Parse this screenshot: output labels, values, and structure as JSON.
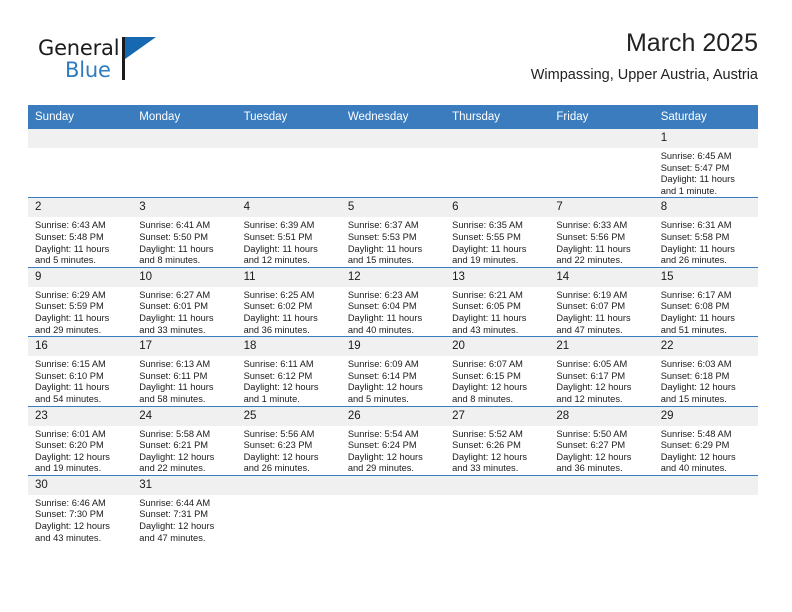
{
  "brand": {
    "name_top": "General",
    "name_bottom": "Blue",
    "triangle_icon": "brand-triangle-icon",
    "accent_color": "#2e7bc0",
    "dark_color": "#1b1b1b"
  },
  "header": {
    "title": "March 2025",
    "subtitle": "Wimpassing, Upper Austria, Austria"
  },
  "theme": {
    "header_blue": "#3a7cbe",
    "daynum_band": "#f0f0f0",
    "grid_line": "#3a7cbe"
  },
  "weekday_headers": [
    "Sunday",
    "Monday",
    "Tuesday",
    "Wednesday",
    "Thursday",
    "Friday",
    "Saturday"
  ],
  "weeks": [
    [
      {
        "day": "",
        "empty": true
      },
      {
        "day": "",
        "empty": true
      },
      {
        "day": "",
        "empty": true
      },
      {
        "day": "",
        "empty": true
      },
      {
        "day": "",
        "empty": true
      },
      {
        "day": "",
        "empty": true
      },
      {
        "day": "1",
        "sunrise": "Sunrise: 6:45 AM",
        "sunset": "Sunset: 5:47 PM",
        "daylight_1": "Daylight: 11 hours",
        "daylight_2": "and 1 minute."
      }
    ],
    [
      {
        "day": "2",
        "sunrise": "Sunrise: 6:43 AM",
        "sunset": "Sunset: 5:48 PM",
        "daylight_1": "Daylight: 11 hours",
        "daylight_2": "and 5 minutes."
      },
      {
        "day": "3",
        "sunrise": "Sunrise: 6:41 AM",
        "sunset": "Sunset: 5:50 PM",
        "daylight_1": "Daylight: 11 hours",
        "daylight_2": "and 8 minutes."
      },
      {
        "day": "4",
        "sunrise": "Sunrise: 6:39 AM",
        "sunset": "Sunset: 5:51 PM",
        "daylight_1": "Daylight: 11 hours",
        "daylight_2": "and 12 minutes."
      },
      {
        "day": "5",
        "sunrise": "Sunrise: 6:37 AM",
        "sunset": "Sunset: 5:53 PM",
        "daylight_1": "Daylight: 11 hours",
        "daylight_2": "and 15 minutes."
      },
      {
        "day": "6",
        "sunrise": "Sunrise: 6:35 AM",
        "sunset": "Sunset: 5:55 PM",
        "daylight_1": "Daylight: 11 hours",
        "daylight_2": "and 19 minutes."
      },
      {
        "day": "7",
        "sunrise": "Sunrise: 6:33 AM",
        "sunset": "Sunset: 5:56 PM",
        "daylight_1": "Daylight: 11 hours",
        "daylight_2": "and 22 minutes."
      },
      {
        "day": "8",
        "sunrise": "Sunrise: 6:31 AM",
        "sunset": "Sunset: 5:58 PM",
        "daylight_1": "Daylight: 11 hours",
        "daylight_2": "and 26 minutes."
      }
    ],
    [
      {
        "day": "9",
        "sunrise": "Sunrise: 6:29 AM",
        "sunset": "Sunset: 5:59 PM",
        "daylight_1": "Daylight: 11 hours",
        "daylight_2": "and 29 minutes."
      },
      {
        "day": "10",
        "sunrise": "Sunrise: 6:27 AM",
        "sunset": "Sunset: 6:01 PM",
        "daylight_1": "Daylight: 11 hours",
        "daylight_2": "and 33 minutes."
      },
      {
        "day": "11",
        "sunrise": "Sunrise: 6:25 AM",
        "sunset": "Sunset: 6:02 PM",
        "daylight_1": "Daylight: 11 hours",
        "daylight_2": "and 36 minutes."
      },
      {
        "day": "12",
        "sunrise": "Sunrise: 6:23 AM",
        "sunset": "Sunset: 6:04 PM",
        "daylight_1": "Daylight: 11 hours",
        "daylight_2": "and 40 minutes."
      },
      {
        "day": "13",
        "sunrise": "Sunrise: 6:21 AM",
        "sunset": "Sunset: 6:05 PM",
        "daylight_1": "Daylight: 11 hours",
        "daylight_2": "and 43 minutes."
      },
      {
        "day": "14",
        "sunrise": "Sunrise: 6:19 AM",
        "sunset": "Sunset: 6:07 PM",
        "daylight_1": "Daylight: 11 hours",
        "daylight_2": "and 47 minutes."
      },
      {
        "day": "15",
        "sunrise": "Sunrise: 6:17 AM",
        "sunset": "Sunset: 6:08 PM",
        "daylight_1": "Daylight: 11 hours",
        "daylight_2": "and 51 minutes."
      }
    ],
    [
      {
        "day": "16",
        "sunrise": "Sunrise: 6:15 AM",
        "sunset": "Sunset: 6:10 PM",
        "daylight_1": "Daylight: 11 hours",
        "daylight_2": "and 54 minutes."
      },
      {
        "day": "17",
        "sunrise": "Sunrise: 6:13 AM",
        "sunset": "Sunset: 6:11 PM",
        "daylight_1": "Daylight: 11 hours",
        "daylight_2": "and 58 minutes."
      },
      {
        "day": "18",
        "sunrise": "Sunrise: 6:11 AM",
        "sunset": "Sunset: 6:12 PM",
        "daylight_1": "Daylight: 12 hours",
        "daylight_2": "and 1 minute."
      },
      {
        "day": "19",
        "sunrise": "Sunrise: 6:09 AM",
        "sunset": "Sunset: 6:14 PM",
        "daylight_1": "Daylight: 12 hours",
        "daylight_2": "and 5 minutes."
      },
      {
        "day": "20",
        "sunrise": "Sunrise: 6:07 AM",
        "sunset": "Sunset: 6:15 PM",
        "daylight_1": "Daylight: 12 hours",
        "daylight_2": "and 8 minutes."
      },
      {
        "day": "21",
        "sunrise": "Sunrise: 6:05 AM",
        "sunset": "Sunset: 6:17 PM",
        "daylight_1": "Daylight: 12 hours",
        "daylight_2": "and 12 minutes."
      },
      {
        "day": "22",
        "sunrise": "Sunrise: 6:03 AM",
        "sunset": "Sunset: 6:18 PM",
        "daylight_1": "Daylight: 12 hours",
        "daylight_2": "and 15 minutes."
      }
    ],
    [
      {
        "day": "23",
        "sunrise": "Sunrise: 6:01 AM",
        "sunset": "Sunset: 6:20 PM",
        "daylight_1": "Daylight: 12 hours",
        "daylight_2": "and 19 minutes."
      },
      {
        "day": "24",
        "sunrise": "Sunrise: 5:58 AM",
        "sunset": "Sunset: 6:21 PM",
        "daylight_1": "Daylight: 12 hours",
        "daylight_2": "and 22 minutes."
      },
      {
        "day": "25",
        "sunrise": "Sunrise: 5:56 AM",
        "sunset": "Sunset: 6:23 PM",
        "daylight_1": "Daylight: 12 hours",
        "daylight_2": "and 26 minutes."
      },
      {
        "day": "26",
        "sunrise": "Sunrise: 5:54 AM",
        "sunset": "Sunset: 6:24 PM",
        "daylight_1": "Daylight: 12 hours",
        "daylight_2": "and 29 minutes."
      },
      {
        "day": "27",
        "sunrise": "Sunrise: 5:52 AM",
        "sunset": "Sunset: 6:26 PM",
        "daylight_1": "Daylight: 12 hours",
        "daylight_2": "and 33 minutes."
      },
      {
        "day": "28",
        "sunrise": "Sunrise: 5:50 AM",
        "sunset": "Sunset: 6:27 PM",
        "daylight_1": "Daylight: 12 hours",
        "daylight_2": "and 36 minutes."
      },
      {
        "day": "29",
        "sunrise": "Sunrise: 5:48 AM",
        "sunset": "Sunset: 6:29 PM",
        "daylight_1": "Daylight: 12 hours",
        "daylight_2": "and 40 minutes."
      }
    ],
    [
      {
        "day": "30",
        "sunrise": "Sunrise: 6:46 AM",
        "sunset": "Sunset: 7:30 PM",
        "daylight_1": "Daylight: 12 hours",
        "daylight_2": "and 43 minutes."
      },
      {
        "day": "31",
        "sunrise": "Sunrise: 6:44 AM",
        "sunset": "Sunset: 7:31 PM",
        "daylight_1": "Daylight: 12 hours",
        "daylight_2": "and 47 minutes."
      },
      {
        "day": "",
        "empty": true
      },
      {
        "day": "",
        "empty": true
      },
      {
        "day": "",
        "empty": true
      },
      {
        "day": "",
        "empty": true
      },
      {
        "day": "",
        "empty": true
      }
    ]
  ]
}
